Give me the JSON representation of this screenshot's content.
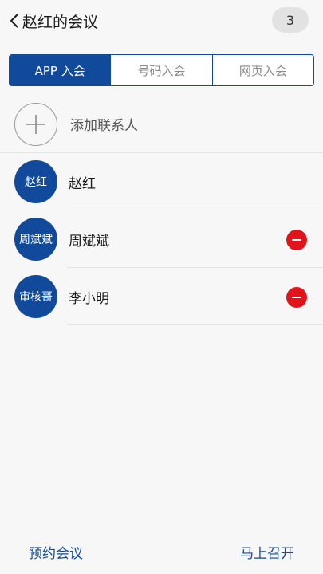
{
  "header": {
    "back_icon": "chevron-left-icon",
    "title": "赵红的会议",
    "participant_count": "3"
  },
  "tabs": [
    {
      "label": "APP 入会",
      "active": true
    },
    {
      "label": "号码入会",
      "active": false
    },
    {
      "label": "网页入会",
      "active": false
    }
  ],
  "add_contact": {
    "icon": "plus-icon",
    "label": "添加联系人"
  },
  "participants": [
    {
      "avatar_text": "赵红",
      "name": "赵红",
      "removable": false
    },
    {
      "avatar_text": "周斌斌",
      "name": "周斌斌",
      "removable": true
    },
    {
      "avatar_text": "审核哥",
      "name": "李小明",
      "removable": true
    }
  ],
  "footer": {
    "schedule_label": "预约会议",
    "start_label": "马上召开"
  },
  "colors": {
    "accent": "#114a9a",
    "remove": "#e0141b"
  }
}
